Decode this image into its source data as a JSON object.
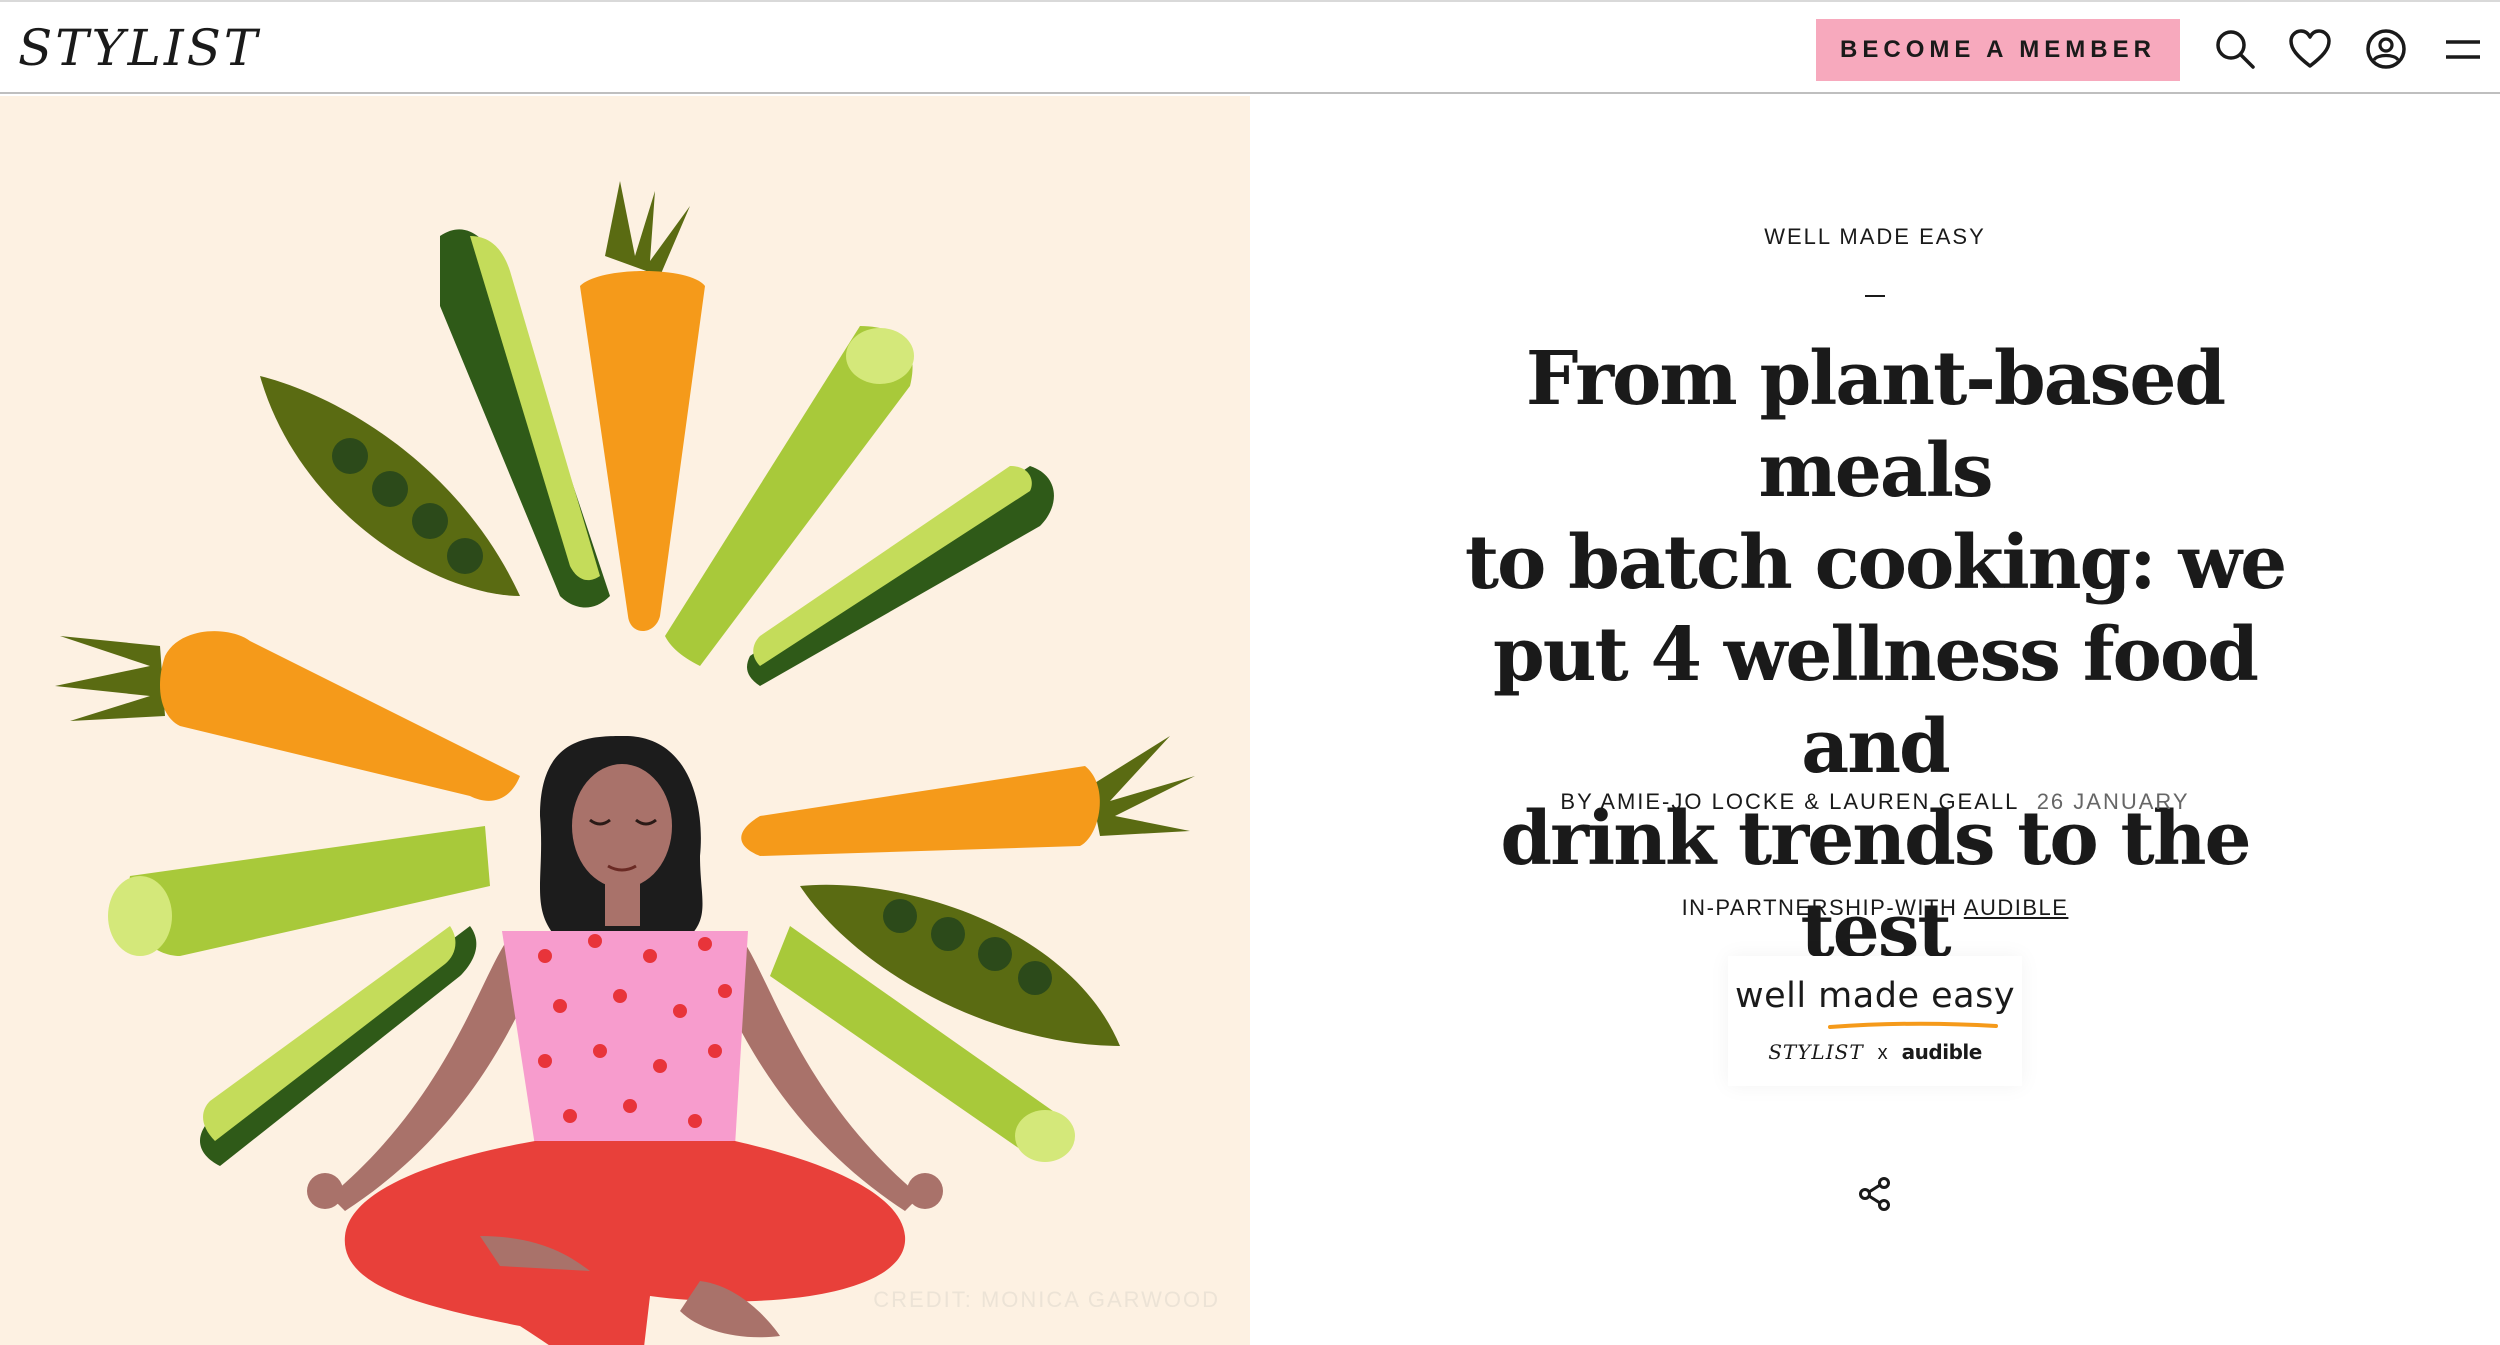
{
  "header": {
    "logo_text": "STYLIST",
    "member_button": "BECOME A MEMBER",
    "icons": [
      "search-icon",
      "heart-icon",
      "account-icon",
      "menu-icon"
    ],
    "accent_color": "#f7a9bd"
  },
  "hero": {
    "background_color": "#fdf1e2",
    "credit": "CREDIT: MONICA GARWOOD"
  },
  "article": {
    "kicker": "WELL MADE EASY",
    "headline_lines": [
      "From plant-based meals",
      "to batch cooking: we",
      "put 4 wellness food and",
      "drink trends to the test"
    ],
    "byline": "BY AMIE-JO LOCKE & LAUREN GEALL",
    "date": "26 JANUARY",
    "partnership_label": "IN-PARTNERSHIP-WITH",
    "partner_link": "AUDIBLE",
    "badge": {
      "title": "well made easy",
      "brand_left": "STYLIST",
      "separator": "x",
      "brand_right": "audible"
    },
    "share_icon": "share-icon"
  }
}
